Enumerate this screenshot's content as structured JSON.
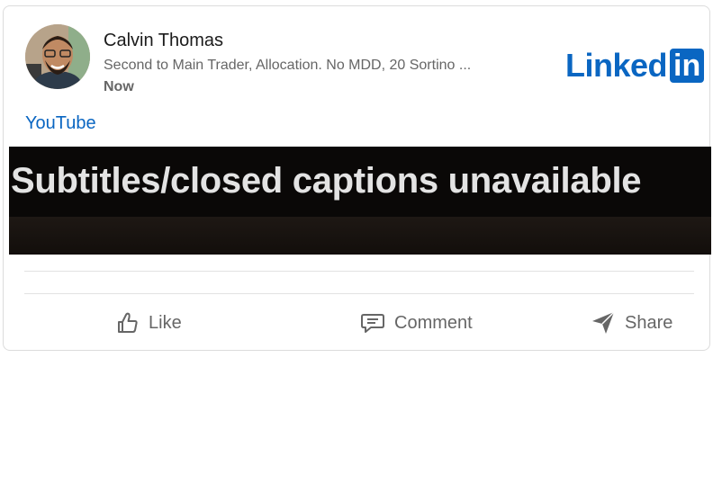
{
  "post": {
    "author_name": "Calvin Thomas",
    "author_headline": "Second to Main Trader, Allocation. No MDD, 20 Sortino ...",
    "time": "Now",
    "brand": {
      "word": "Linked",
      "box": "in"
    },
    "source_link": "YouTube",
    "media_caption": "Subtitles/closed captions unavailable"
  },
  "actions": {
    "like": "Like",
    "comment": "Comment",
    "share": "Share"
  },
  "colors": {
    "brand": "#0a66c2",
    "secondary_text": "#666666"
  },
  "icons": [
    "thumbs-up-icon",
    "comment-icon",
    "send-icon"
  ]
}
